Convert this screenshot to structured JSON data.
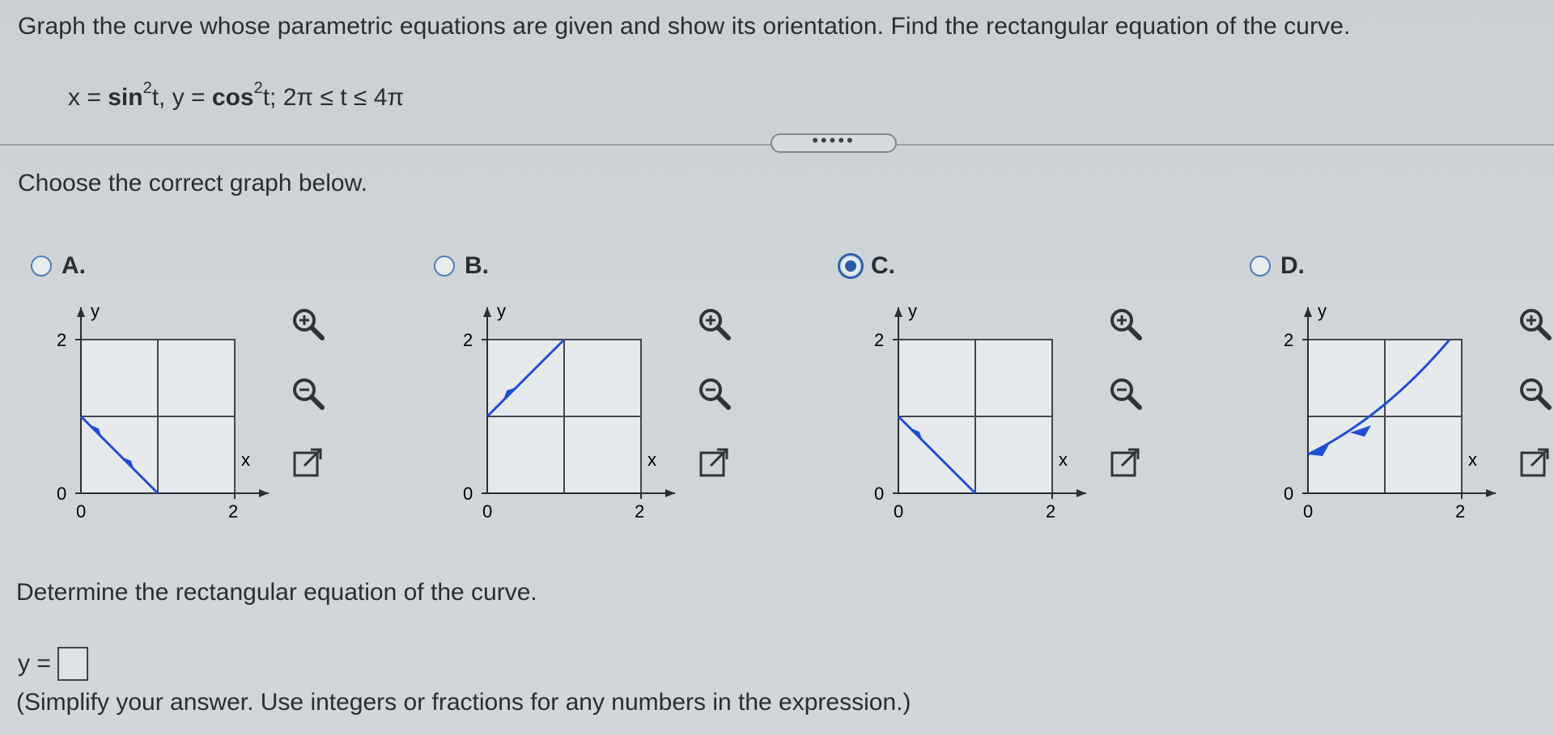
{
  "question_text": "Graph the curve whose parametric equations are given and show its orientation. Find the rectangular equation of the curve.",
  "equation": {
    "x_part": "x = ",
    "sin": "sin",
    "exp1": "2",
    "mid": "t, y = ",
    "cos": "cos",
    "exp2": "2",
    "tail": "t; 2π ≤ t ≤ 4π"
  },
  "more_button_label": "•••••",
  "prompt": "Choose the correct graph below.",
  "options": [
    {
      "letter": "A.",
      "selected": false,
      "y_label": "y",
      "x_label": "x",
      "tick_y_top": "2",
      "tick_y_bottom": "0",
      "tick_x_left": "0",
      "tick_x_right": "2"
    },
    {
      "letter": "B.",
      "selected": false,
      "y_label": "y",
      "x_label": "x",
      "tick_y_top": "2",
      "tick_y_bottom": "0",
      "tick_x_left": "0",
      "tick_x_right": "2"
    },
    {
      "letter": "C.",
      "selected": true,
      "y_label": "y",
      "x_label": "x",
      "tick_y_top": "2",
      "tick_y_bottom": "0",
      "tick_x_left": "0",
      "tick_x_right": "2"
    },
    {
      "letter": "D.",
      "selected": false,
      "y_label": "y",
      "x_label": "x",
      "tick_y_top": "2",
      "tick_y_bottom": "0",
      "tick_x_left": "0",
      "tick_x_right": "2"
    }
  ],
  "tool_icons": [
    "zoom-in-icon",
    "zoom-out-icon",
    "popout-icon"
  ],
  "determine_text": "Determine the rectangular equation of the curve.",
  "answer_prefix": "y =",
  "hint": "(Simplify your answer. Use integers or fractions for any numbers in the expression.)",
  "colors": {
    "curve": "#1f4fd1",
    "radio_selected": "#2b5ea8"
  }
}
